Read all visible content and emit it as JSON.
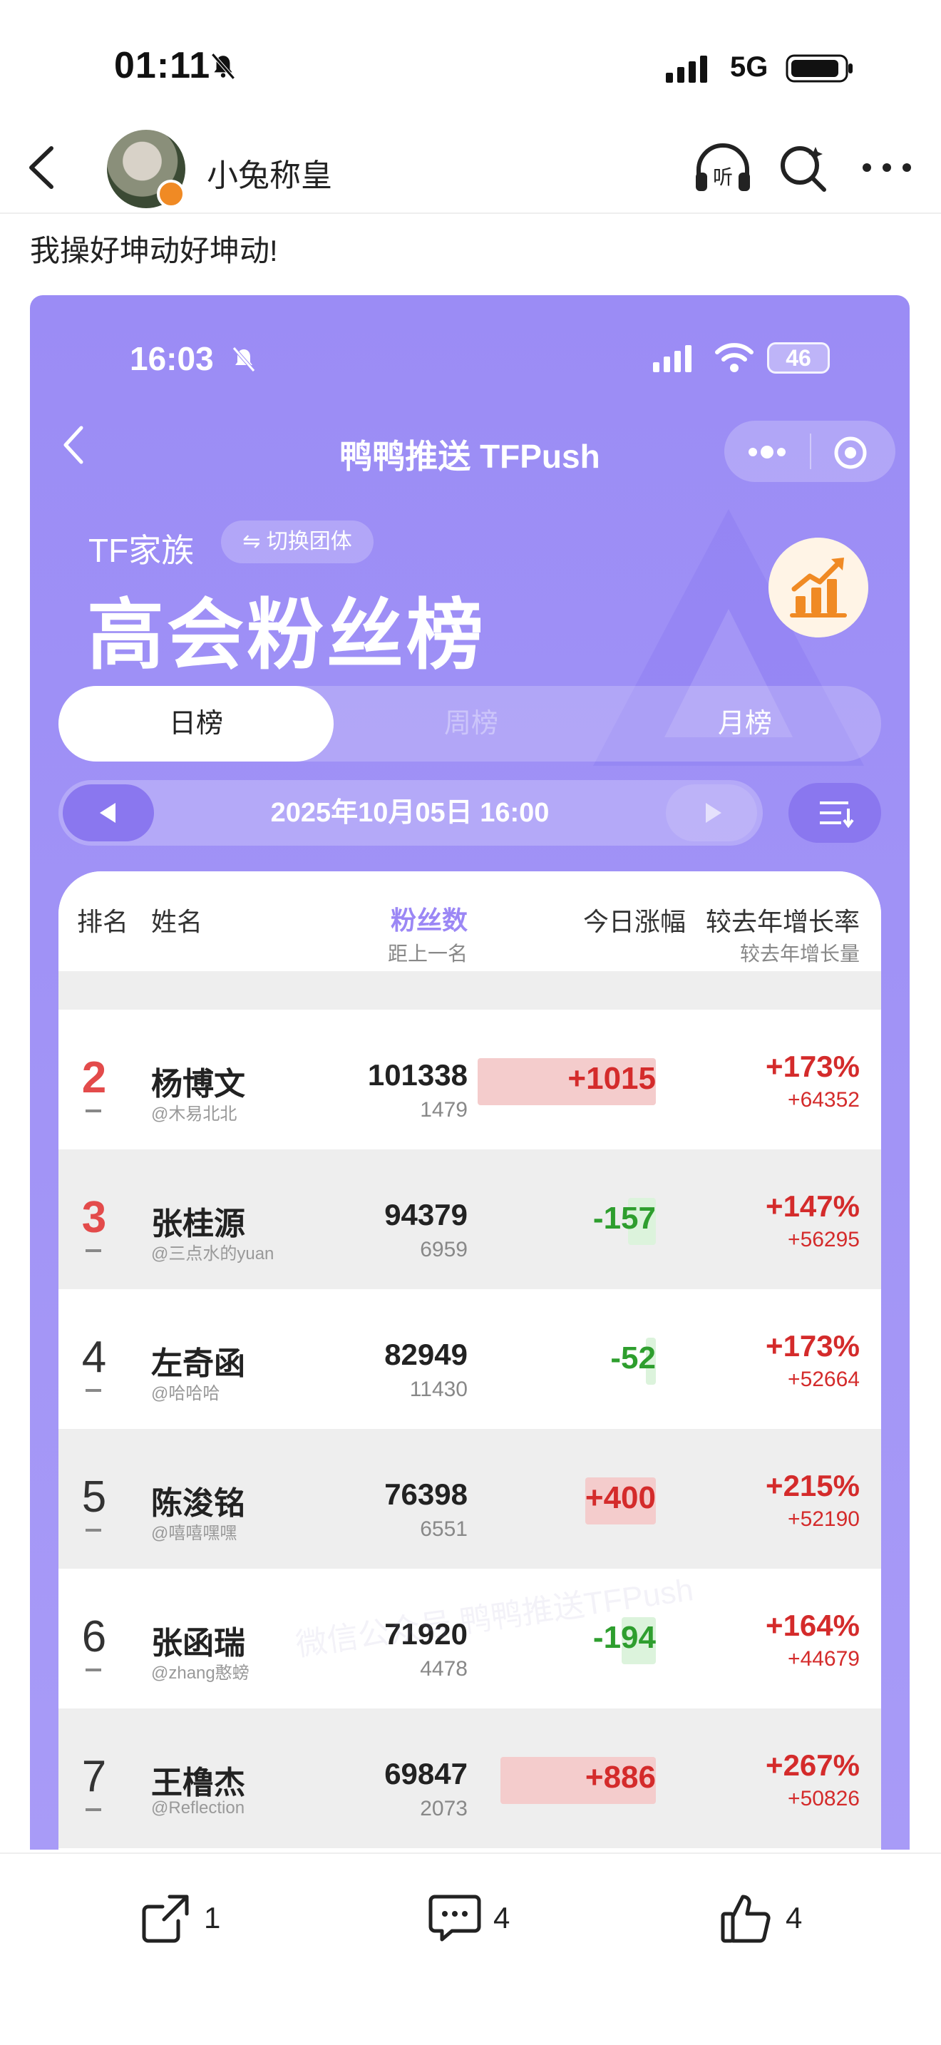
{
  "status_bar": {
    "time": "01:11",
    "network": "5G"
  },
  "post": {
    "author": "小兔称皇",
    "text": "我操好坤动好坤动!"
  },
  "embedded": {
    "status_time": "16:03",
    "battery": "46",
    "app_title": "鸭鸭推送 TFPush",
    "family": "TF家族",
    "switch_label": "⇋ 切换团体",
    "board_title": "高会粉丝榜",
    "tabs": {
      "daily": "日榜",
      "weekly": "周榜",
      "monthly": "月榜"
    },
    "date": "2025年10月05日 16:00",
    "watermark": "微信公众号 鸭鸭推送TFPush",
    "table": {
      "headers": {
        "rank": "排名",
        "name": "姓名",
        "fans": "粉丝数",
        "fans_sub": "距上一名",
        "today": "今日涨幅",
        "yoy": "较去年增长率",
        "yoy_sub": "较去年增长量"
      },
      "rows": [
        {
          "rank": "2",
          "name": "杨博文",
          "handle": "@木易北北",
          "fans": "101338",
          "gap": "1479",
          "today": "+1015",
          "today_value": 1015,
          "yoy_rate": "+173%",
          "yoy_abs": "+64352"
        },
        {
          "rank": "3",
          "name": "张桂源",
          "handle": "@三点水的yuan",
          "fans": "94379",
          "gap": "6959",
          "today": "-157",
          "today_value": -157,
          "yoy_rate": "+147%",
          "yoy_abs": "+56295"
        },
        {
          "rank": "4",
          "name": "左奇函",
          "handle": "@哈哈哈",
          "fans": "82949",
          "gap": "11430",
          "today": "-52",
          "today_value": -52,
          "yoy_rate": "+173%",
          "yoy_abs": "+52664"
        },
        {
          "rank": "5",
          "name": "陈浚铭",
          "handle": "@嘻嘻嘿嘿",
          "fans": "76398",
          "gap": "6551",
          "today": "+400",
          "today_value": 400,
          "yoy_rate": "+215%",
          "yoy_abs": "+52190"
        },
        {
          "rank": "6",
          "name": "张函瑞",
          "handle": "@zhang憨螃",
          "fans": "71920",
          "gap": "4478",
          "today": "-194",
          "today_value": -194,
          "yoy_rate": "+164%",
          "yoy_abs": "+44679"
        },
        {
          "rank": "7",
          "name": "王橹杰",
          "handle": "@Reflection",
          "fans": "69847",
          "gap": "2073",
          "today": "+886",
          "today_value": 886,
          "yoy_rate": "+267%",
          "yoy_abs": "+50826"
        }
      ]
    }
  },
  "actions": {
    "share_count": "1",
    "comment_count": "4",
    "like_count": "4"
  },
  "colors": {
    "accent": "#9b8cf5",
    "up": "#d42b2b",
    "down": "#2e9e2e"
  }
}
